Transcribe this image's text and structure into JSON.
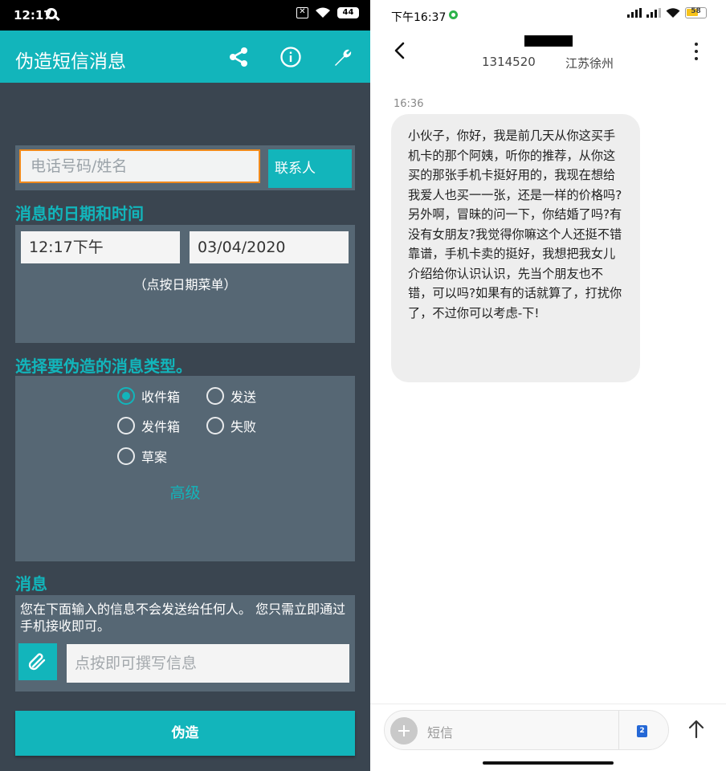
{
  "left": {
    "status_bar": {
      "time": "12:17",
      "battery": "44"
    },
    "app_bar": {
      "title": "伪造短信消息"
    },
    "recipient": {
      "placeholder": "电话号码/姓名",
      "contacts_button": "联系人"
    },
    "datetime_section": {
      "heading": "消息的日期和时间",
      "time_value": "12:17下午",
      "date_value": "03/04/2020",
      "hint": "（点按日期菜单）"
    },
    "type_section": {
      "heading": "选择要伪造的消息类型。",
      "options": [
        {
          "label": "收件箱",
          "selected": true
        },
        {
          "label": "发送",
          "selected": false
        },
        {
          "label": "发件箱",
          "selected": false
        },
        {
          "label": "失败",
          "selected": false
        },
        {
          "label": "草案",
          "selected": false
        }
      ],
      "advanced_label": "高级"
    },
    "message_section": {
      "heading": "消息",
      "note": "您在下面输入的信息不会发送给任何人。 您只需立即通过手机接收即可。",
      "compose_placeholder": "点按即可撰写信息"
    },
    "forge_button": "伪造",
    "colors": {
      "accent": "#12b5bb",
      "background": "#3a4550",
      "panel": "#566774",
      "focus_border": "#f08a1c"
    }
  },
  "right": {
    "status_bar": {
      "time": "下午16:37",
      "battery": "58"
    },
    "conversation": {
      "number": "1314520",
      "location": "江苏徐州"
    },
    "message": {
      "time": "16:36",
      "text": "小伙子，你好，我是前几天从你这买手机卡的那个阿姨，听你的推荐，从你这买的那张手机卡挺好用的，我现在想给我爱人也买一一张，还是一样的价格吗?另外啊，冒昧的问一下，你结婚了吗?有没有女朋友?我觉得你嘛这个人还挺不错靠谱，手机卡卖的挺好，我想把我女儿介绍给你认识认识，先当个朋友也不错，可以吗?如果有的话就算了，打扰你了，不过你可以考虑-下!"
    },
    "compose": {
      "placeholder": "短信",
      "sim_label": "2"
    },
    "colors": {
      "bubble": "#eeeeee",
      "sim_icon": "#2568d6",
      "status_dot": "#2cb34a"
    }
  }
}
